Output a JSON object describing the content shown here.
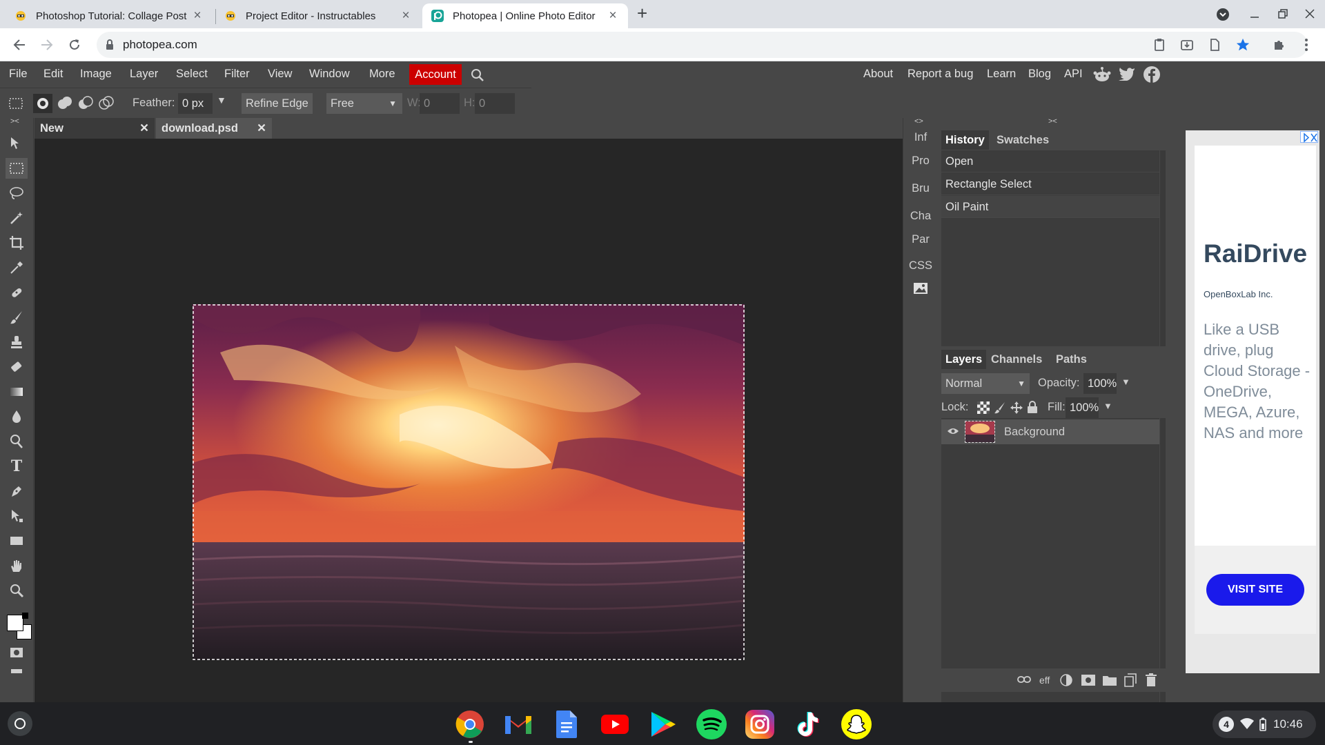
{
  "browser": {
    "tabs": [
      {
        "title": "Photoshop Tutorial: Collage Post",
        "favicon": "instructables-robot"
      },
      {
        "title": "Project Editor - Instructables",
        "favicon": "instructables-robot"
      },
      {
        "title": "Photopea | Online Photo Editor",
        "favicon": "photopea-logo"
      }
    ],
    "url": "photopea.com",
    "new_tab": "+"
  },
  "app": {
    "menus": [
      "File",
      "Edit",
      "Image",
      "Layer",
      "Select",
      "Filter",
      "View",
      "Window",
      "More"
    ],
    "account": "Account",
    "right_links": [
      "About",
      "Report a bug",
      "Learn",
      "Blog",
      "API"
    ],
    "options": {
      "feather_label": "Feather:",
      "feather_value": "0 px",
      "refine_edge": "Refine Edge",
      "style": "Free",
      "w_label": "W:",
      "w_value": "0",
      "h_label": "H:",
      "h_value": "0"
    },
    "doc_tabs": [
      {
        "name": "New Project.psd",
        "close": "✕"
      },
      {
        "name": "download.psd *",
        "close": "✕"
      }
    ],
    "mini_panels": [
      "Inf",
      "Pro",
      "Bru",
      "Cha",
      "Par",
      "CSS"
    ],
    "collapse_left": "<>",
    "collapse_right": "><",
    "history_tabs": [
      "History",
      "Swatches"
    ],
    "history_items": [
      "Open",
      "Rectangle Select",
      "Oil Paint"
    ],
    "layers_tabs": [
      "Layers",
      "Channels",
      "Paths"
    ],
    "blend_mode": "Normal",
    "opacity_label": "Opacity:",
    "opacity_value": "100%",
    "lock_label": "Lock:",
    "fill_label": "Fill:",
    "fill_value": "100%",
    "layers": [
      {
        "name": "Background",
        "visible": true
      }
    ],
    "footer_eff": "eff"
  },
  "ad": {
    "title": "RaiDrive",
    "company": "OpenBoxLab Inc.",
    "body": "Like a USB drive, plug Cloud Storage - OneDrive, MEGA, Azure, NAS and more",
    "cta": "VISIT SITE"
  },
  "shelf": {
    "apps": [
      "chrome-icon",
      "gmail-icon",
      "docs-icon",
      "youtube-icon",
      "play-store-icon",
      "spotify-icon",
      "instagram-icon",
      "tiktok-icon",
      "snapchat-icon"
    ],
    "notification_count": "4",
    "time": "10:46"
  },
  "colors": {
    "accent_account": "#cc0000",
    "ad_cta": "#1a1aeb",
    "canvas_bg": "#262626"
  }
}
